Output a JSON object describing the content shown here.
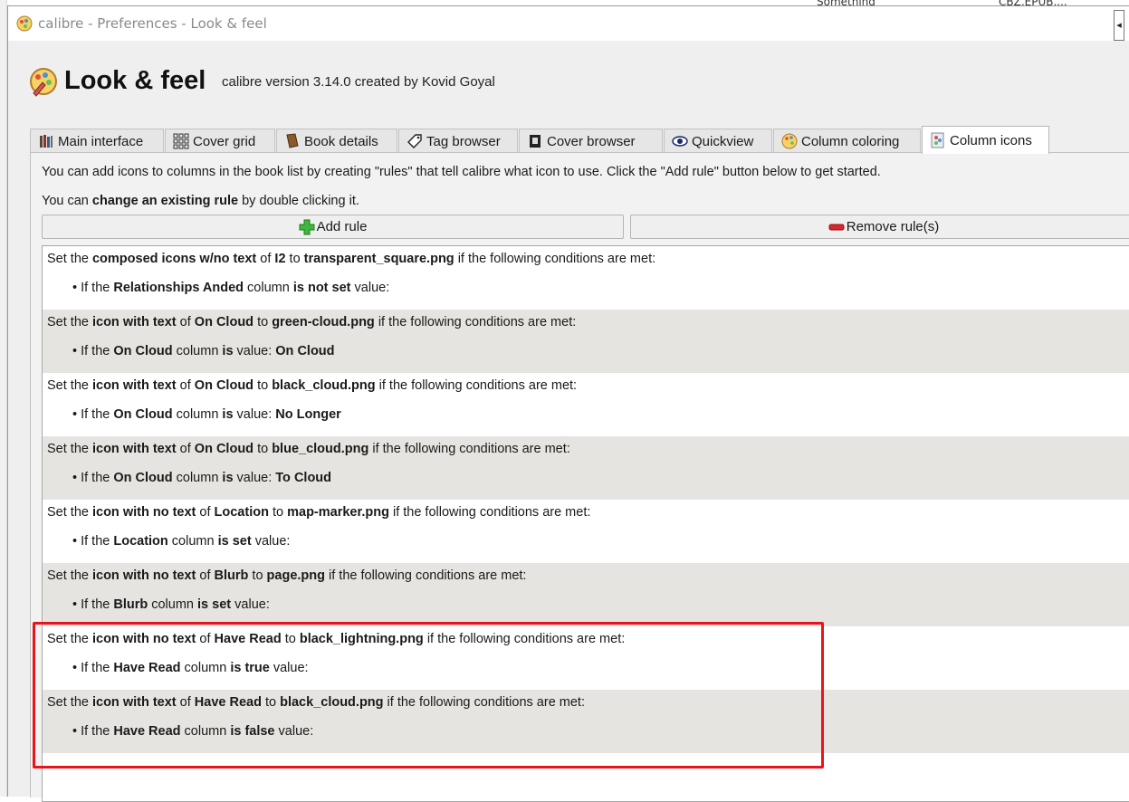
{
  "background": {
    "top_left_text": "Something",
    "top_right_text": "CBZ,EPUB,..."
  },
  "window": {
    "title": "calibre - Preferences - Look & feel",
    "control_glyph": "◂"
  },
  "header": {
    "title": "Look & feel",
    "version": "calibre version 3.14.0 created by Kovid Goyal"
  },
  "tabs": [
    {
      "label": "Main interface",
      "icon": "books-icon"
    },
    {
      "label": "Cover grid",
      "icon": "grid-icon"
    },
    {
      "label": "Book details",
      "icon": "book-icon"
    },
    {
      "label": "Tag browser",
      "icon": "tag-icon"
    },
    {
      "label": "Cover browser",
      "icon": "cover-icon"
    },
    {
      "label": "Quickview",
      "icon": "eye-icon"
    },
    {
      "label": "Column coloring",
      "icon": "palette-icon"
    },
    {
      "label": "Column icons",
      "icon": "palette-card-icon",
      "active": true
    }
  ],
  "panel": {
    "intro_line1": "You can add icons to columns in the book list by creating \"rules\" that tell calibre what icon to use. Click the \"Add rule\" button below to get started.",
    "intro_line2_pre": "You can ",
    "intro_line2_bold": "change an existing rule",
    "intro_line2_post": " by double clicking it.",
    "add_rule_label": "Add rule",
    "remove_rule_label": "Remove rule(s)"
  },
  "rules": [
    {
      "kind": "composed icons w/no text",
      "column": "I2",
      "icon": "transparent_square.png",
      "cond_column": "Relationships Anded",
      "cond_op": "is not set",
      "cond_value": ""
    },
    {
      "kind": "icon with text",
      "column": "On Cloud",
      "icon": "green-cloud.png",
      "cond_column": "On Cloud",
      "cond_op": "is",
      "cond_value": "On Cloud"
    },
    {
      "kind": "icon with text",
      "column": "On Cloud",
      "icon": "black_cloud.png",
      "cond_column": "On Cloud",
      "cond_op": "is",
      "cond_value": "No Longer"
    },
    {
      "kind": "icon with text",
      "column": "On Cloud",
      "icon": "blue_cloud.png",
      "cond_column": "On Cloud",
      "cond_op": "is",
      "cond_value": "To Cloud"
    },
    {
      "kind": "icon with no text",
      "column": "Location",
      "icon": "map-marker.png",
      "cond_column": "Location",
      "cond_op": "is set",
      "cond_value": ""
    },
    {
      "kind": "icon with no text",
      "column": "Blurb",
      "icon": "page.png",
      "cond_column": "Blurb",
      "cond_op": "is set",
      "cond_value": ""
    },
    {
      "kind": "icon with no text",
      "column": "Have Read",
      "icon": "black_lightning.png",
      "cond_column": "Have Read",
      "cond_op": "is true",
      "cond_value": ""
    },
    {
      "kind": "icon with text",
      "column": "Have Read",
      "icon": "black_cloud.png",
      "cond_column": "Have Read",
      "cond_op": "is false",
      "cond_value": ""
    }
  ],
  "text": {
    "set_the": "Set the ",
    "of": " of ",
    "to": " to ",
    "conditions_tail": " if the following conditions are met:",
    "if_the": "If the ",
    "column": " column ",
    "value": " value:"
  },
  "colors": {
    "highlight_box": "#e8141b",
    "alt_row": "#e6e4e1"
  }
}
